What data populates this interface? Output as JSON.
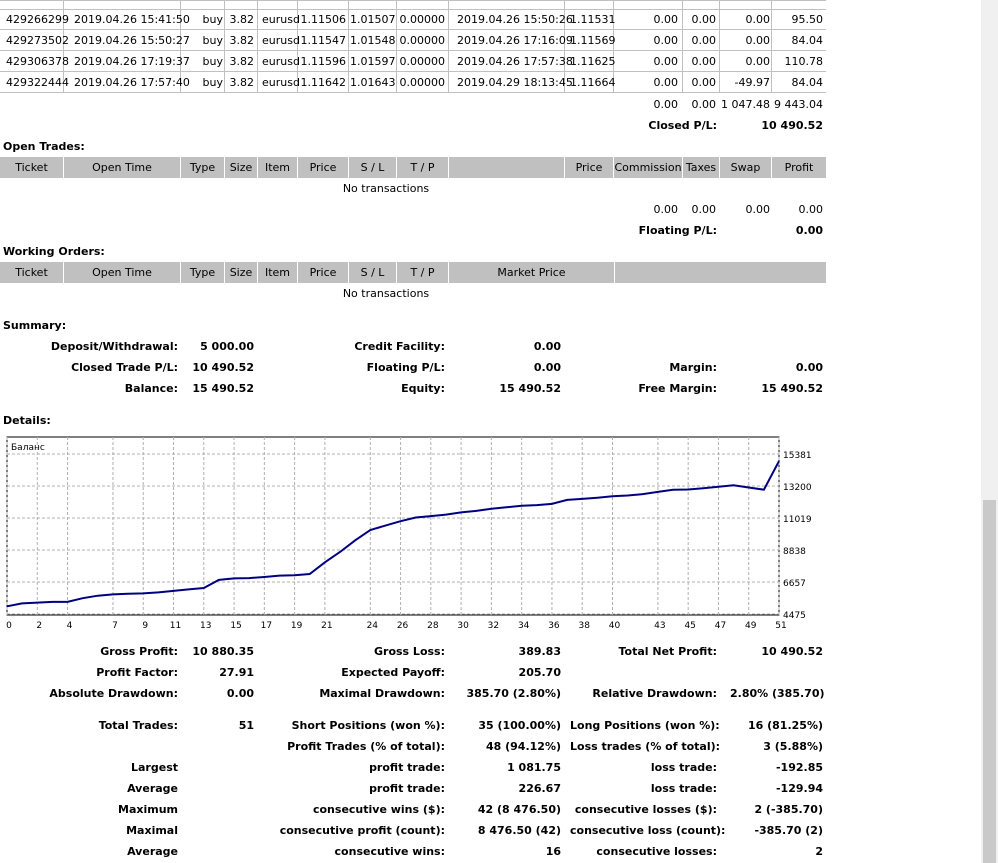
{
  "closed_trades": [
    {
      "ticket": "429266299",
      "open_time": "2019.04.26 15:41:50",
      "type": "buy",
      "size": "3.82",
      "item": "eurusd",
      "price": "1.11506",
      "sl": "1.01507",
      "tp": "0.00000",
      "close_time": "2019.04.26 15:50:26",
      "close_price": "1.11531",
      "commission": "0.00",
      "taxes": "0.00",
      "swap": "0.00",
      "profit": "95.50"
    },
    {
      "ticket": "429273502",
      "open_time": "2019.04.26 15:50:27",
      "type": "buy",
      "size": "3.82",
      "item": "eurusd",
      "price": "1.11547",
      "sl": "1.01548",
      "tp": "0.00000",
      "close_time": "2019.04.26 17:16:09",
      "close_price": "1.11569",
      "commission": "0.00",
      "taxes": "0.00",
      "swap": "0.00",
      "profit": "84.04"
    },
    {
      "ticket": "429306378",
      "open_time": "2019.04.26 17:19:37",
      "type": "buy",
      "size": "3.82",
      "item": "eurusd",
      "price": "1.11596",
      "sl": "1.01597",
      "tp": "0.00000",
      "close_time": "2019.04.26 17:57:38",
      "close_price": "1.11625",
      "commission": "0.00",
      "taxes": "0.00",
      "swap": "0.00",
      "profit": "110.78"
    },
    {
      "ticket": "429322444",
      "open_time": "2019.04.26 17:57:40",
      "type": "buy",
      "size": "3.82",
      "item": "eurusd",
      "price": "1.11642",
      "sl": "1.01643",
      "tp": "0.00000",
      "close_time": "2019.04.29 18:13:45",
      "close_price": "1.11664",
      "commission": "0.00",
      "taxes": "0.00",
      "swap": "-49.97",
      "profit": "84.04"
    }
  ],
  "closed_totals": {
    "commission": "0.00",
    "taxes": "0.00",
    "swap": "1 047.48",
    "profit": "9 443.04",
    "pl_label": "Closed P/L:",
    "pl_value": "10 490.52"
  },
  "open_trades": {
    "title": "Open Trades:",
    "headers": {
      "ticket": "Ticket",
      "open_time": "Open Time",
      "type": "Type",
      "size": "Size",
      "item": "Item",
      "price": "Price",
      "sl": "S / L",
      "tp": "T / P",
      "price2": "Price",
      "commission": "Commission",
      "taxes": "Taxes",
      "swap": "Swap",
      "profit": "Profit"
    },
    "empty": "No transactions",
    "totals": {
      "commission": "0.00",
      "taxes": "0.00",
      "swap": "0.00",
      "profit": "0.00"
    },
    "pl_label": "Floating P/L:",
    "pl_value": "0.00"
  },
  "working_orders": {
    "title": "Working Orders:",
    "headers": {
      "ticket": "Ticket",
      "open_time": "Open Time",
      "type": "Type",
      "size": "Size",
      "item": "Item",
      "price": "Price",
      "sl": "S / L",
      "tp": "T / P",
      "market_price": "Market Price"
    },
    "empty": "No transactions"
  },
  "summary": {
    "title": "Summary:",
    "deposit_label": "Deposit/Withdrawal:",
    "deposit": "5 000.00",
    "credit_label": "Credit Facility:",
    "credit": "0.00",
    "closed_pl_label": "Closed Trade P/L:",
    "closed_pl": "10 490.52",
    "floating_label": "Floating P/L:",
    "floating": "0.00",
    "margin_label": "Margin:",
    "margin": "0.00",
    "balance_label": "Balance:",
    "balance": "15 490.52",
    "equity_label": "Equity:",
    "equity": "15 490.52",
    "free_margin_label": "Free Margin:",
    "free_margin": "15 490.52"
  },
  "details": {
    "title": "Details:"
  },
  "chart_data": {
    "type": "line",
    "title": "Баланс",
    "y_ticks": [
      "15381",
      "13200",
      "11019",
      "8838",
      "6657",
      "4475"
    ],
    "x_ticks": [
      "0",
      "2",
      "4",
      "7",
      "9",
      "11",
      "13",
      "15",
      "17",
      "19",
      "21",
      "24",
      "26",
      "28",
      "30",
      "32",
      "34",
      "36",
      "38",
      "40",
      "43",
      "45",
      "47",
      "49",
      "51"
    ],
    "ylim": [
      4475,
      15381
    ],
    "xlim": [
      0,
      51
    ],
    "grid": true,
    "line_color": "#000080",
    "x": [
      0,
      1,
      2,
      3,
      4,
      5,
      6,
      7,
      8,
      9,
      10,
      11,
      12,
      13,
      14,
      15,
      16,
      17,
      18,
      19,
      20,
      21,
      22,
      23,
      24,
      25,
      26,
      27,
      28,
      29,
      30,
      31,
      32,
      33,
      34,
      35,
      36,
      37,
      38,
      39,
      40,
      41,
      42,
      43,
      44,
      45,
      46,
      47,
      48,
      49,
      50,
      51
    ],
    "values": [
      5000,
      5200,
      5250,
      5300,
      5300,
      5550,
      5720,
      5810,
      5850,
      5880,
      5950,
      6050,
      6150,
      6250,
      6800,
      6900,
      6920,
      7000,
      7090,
      7120,
      7200,
      8000,
      8700,
      9500,
      10200,
      10500,
      10800,
      11050,
      11150,
      11250,
      11400,
      11500,
      11650,
      11750,
      11850,
      11900,
      11980,
      12250,
      12320,
      12400,
      12500,
      12550,
      12650,
      12800,
      12950,
      12960,
      13050,
      13150,
      13250,
      13100,
      12950,
      14900
    ]
  },
  "stats": {
    "gross_profit_label": "Gross Profit:",
    "gross_profit": "10 880.35",
    "gross_loss_label": "Gross Loss:",
    "gross_loss": "389.83",
    "total_net_label": "Total Net Profit:",
    "total_net": "10 490.52",
    "profit_factor_label": "Profit Factor:",
    "profit_factor": "27.91",
    "expected_payoff_label": "Expected Payoff:",
    "expected_payoff": "205.70",
    "abs_dd_label": "Absolute Drawdown:",
    "abs_dd": "0.00",
    "max_dd_label": "Maximal Drawdown:",
    "max_dd": "385.70 (2.80%)",
    "rel_dd_label": "Relative Drawdown:",
    "rel_dd": "2.80% (385.70)",
    "total_trades_label": "Total Trades:",
    "total_trades": "51",
    "short_label": "Short Positions (won %):",
    "short": "35 (100.00%)",
    "long_label": "Long Positions (won %):",
    "long": "16 (81.25%)",
    "profit_trades_label": "Profit Trades (% of total):",
    "profit_trades": "48 (94.12%)",
    "loss_trades_label": "Loss trades (% of total):",
    "loss_trades": "3 (5.88%)",
    "largest": "Largest",
    "largest_profit_label": "profit trade:",
    "largest_profit": "1 081.75",
    "largest_loss_label": "loss trade:",
    "largest_loss": "-192.85",
    "average": "Average",
    "avg_profit_label": "profit trade:",
    "avg_profit": "226.67",
    "avg_loss_label": "loss trade:",
    "avg_loss": "-129.94",
    "maximum": "Maximum",
    "max_cw_label": "consecutive wins ($):",
    "max_cw": "42 (8 476.50)",
    "max_cl_label": "consecutive losses ($):",
    "max_cl": "2 (-385.70)",
    "maximal": "Maximal",
    "maximal_cp_label": "consecutive profit (count):",
    "maximal_cp": "8 476.50 (42)",
    "maximal_cl_label": "consecutive loss (count):",
    "maximal_cl": "-385.70 (2)",
    "average2": "Average",
    "avg_cw_label": "consecutive wins:",
    "avg_cw": "16",
    "avg_cl_label": "consecutive losses:",
    "avg_cl": "2"
  }
}
